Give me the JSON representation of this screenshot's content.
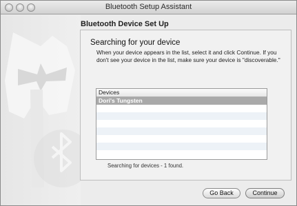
{
  "window": {
    "title": "Bluetooth Setup Assistant"
  },
  "section": {
    "title": "Bluetooth Device Set Up"
  },
  "panel": {
    "heading": "Searching for your device",
    "instructions": "When your device appears in the list, select it and click Continue. If you don't see your device in the list, make sure your device is \"discoverable.\"",
    "devices_header": "Devices",
    "devices": [
      {
        "name": "Dori's Tungsten",
        "selected": true
      }
    ],
    "status": "Searching for devices - 1 found."
  },
  "buttons": {
    "back": "Go Back",
    "continue": "Continue"
  }
}
